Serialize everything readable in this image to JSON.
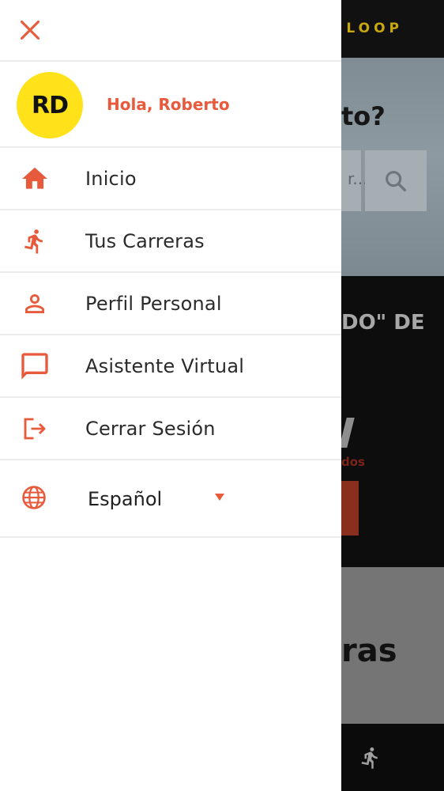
{
  "background": {
    "brand": "LOOP",
    "hero_title": "to?",
    "search_placeholder": "r...",
    "section_title": "DO\" DE",
    "link_text": "dos",
    "card_title": "ras"
  },
  "drawer": {
    "greeting": "Hola, Roberto",
    "avatar_initials": "RD",
    "menu": [
      {
        "label": "Inicio",
        "icon": "home-icon"
      },
      {
        "label": "Tus Carreras",
        "icon": "runner-icon"
      },
      {
        "label": "Perfil Personal",
        "icon": "person-icon"
      },
      {
        "label": "Asistente Virtual",
        "icon": "chat-icon"
      },
      {
        "label": "Cerrar Sesión",
        "icon": "logout-icon"
      }
    ],
    "language": {
      "selected": "Español",
      "icon": "globe-icon"
    }
  },
  "colors": {
    "accent": "#e85a3c",
    "avatar_bg": "#ffe21a",
    "brand_yellow": "#c9a80e"
  }
}
